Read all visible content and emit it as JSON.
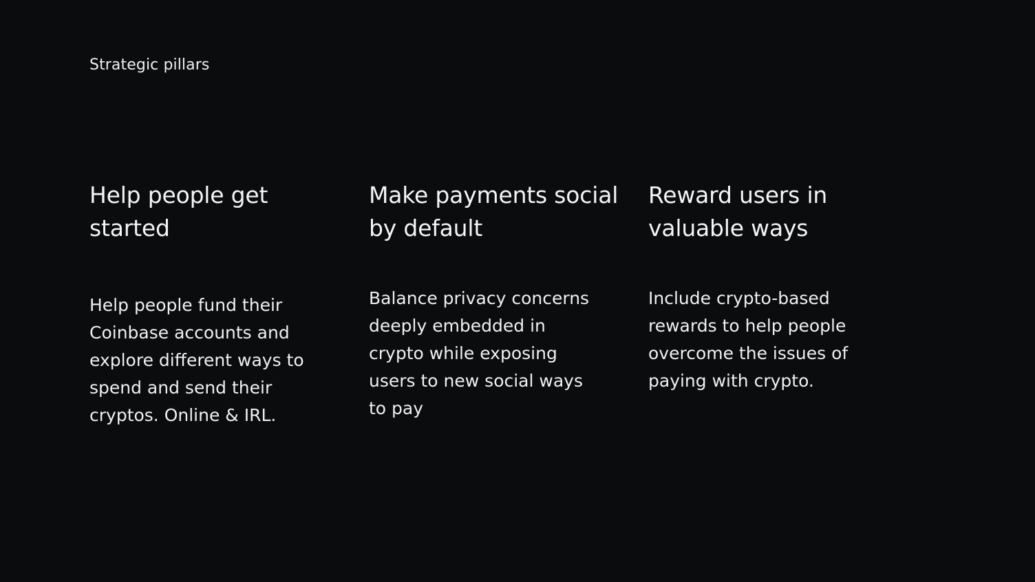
{
  "header": {
    "eyebrow": "Strategic pillars"
  },
  "pillars": [
    {
      "title": "Help people get\nstarted",
      "body": "Help people fund their\nCoinbase accounts and\nexplore different ways to\nspend and send their\ncryptos. Online & IRL."
    },
    {
      "title": "Make payments social\nby default",
      "body": "Balance privacy concerns\ndeeply embedded in\ncrypto while exposing\nusers to new social ways\nto pay"
    },
    {
      "title": "Reward users in\nvaluable ways",
      "body": "Include crypto-based\nrewards to help people\novercome the issues of\npaying with crypto."
    }
  ],
  "colors": {
    "background": "#0b0c0e",
    "text": "#f3f3f3"
  }
}
